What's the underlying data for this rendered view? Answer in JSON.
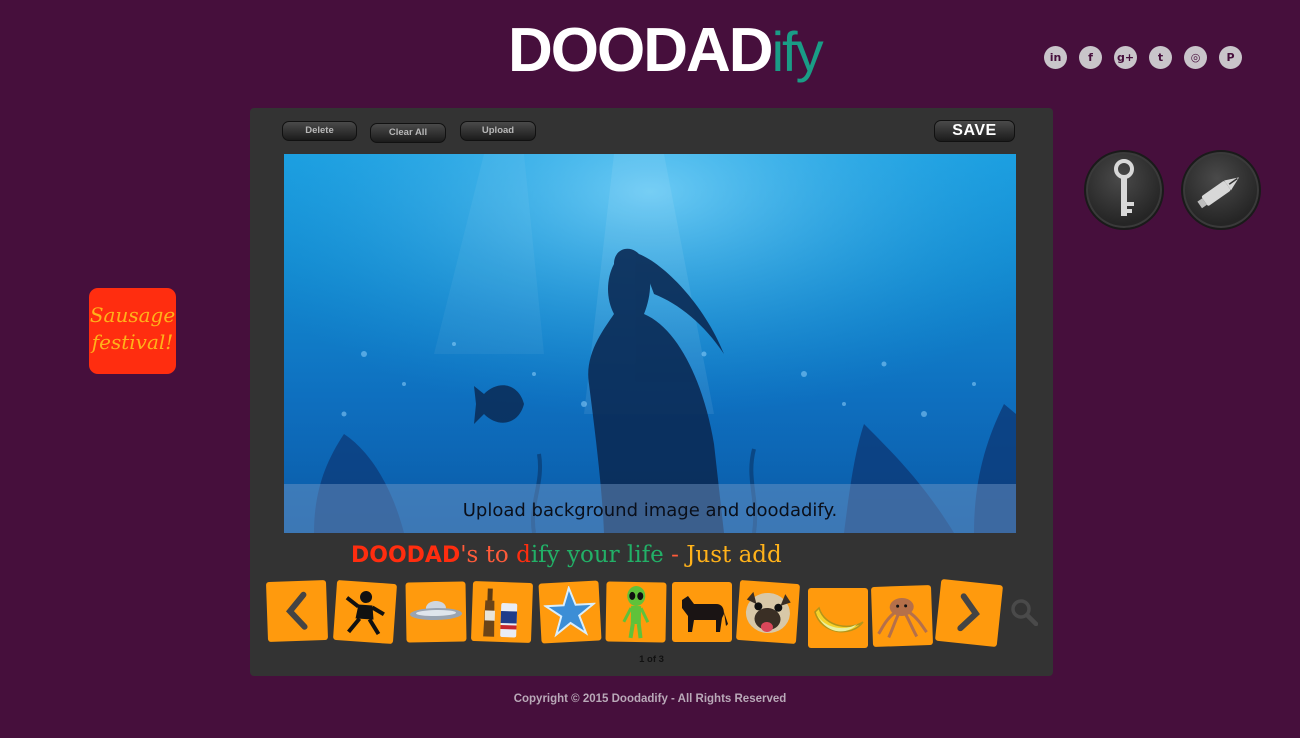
{
  "logo": {
    "main": "DOODAD",
    "suffix": "ify"
  },
  "social": [
    {
      "icon": "linkedin-icon",
      "glyph": "in"
    },
    {
      "icon": "facebook-icon",
      "glyph": "f"
    },
    {
      "icon": "google-plus-icon",
      "glyph": "g+"
    },
    {
      "icon": "twitter-icon",
      "glyph": "t"
    },
    {
      "icon": "instagram-icon",
      "glyph": "◎"
    },
    {
      "icon": "pinterest-icon",
      "glyph": "P"
    }
  ],
  "sticker": {
    "line1": "Sausage",
    "line2": "festival!"
  },
  "toolbar": {
    "delete": "Delete",
    "clear_all": "Clear All",
    "upload": "Upload",
    "save": "SAVE"
  },
  "canvas": {
    "hint": "Upload background image and doodadify."
  },
  "tagline": {
    "doodad": "DOODAD",
    "apostrophe_s": "'s",
    "to": " to ",
    "d": "d",
    "ify": "ify",
    "your_life": " your life",
    "dash": " - ",
    "just_add": "Just add"
  },
  "carousel": {
    "items": [
      "ninja",
      "ufo",
      "beer",
      "star",
      "alien",
      "horse",
      "pug",
      "banana",
      "octopus"
    ],
    "pager": "1 of 3"
  },
  "footer": {
    "copyright": "Copyright © 2015 Doodadify - All Rights Reserved"
  },
  "colors": {
    "background": "#460f3c",
    "panel": "#333333",
    "accent_orange": "#ff9a0d",
    "accent_red": "#ff2d0f",
    "accent_green": "#22b067",
    "logo_teal": "#1a9c86"
  }
}
